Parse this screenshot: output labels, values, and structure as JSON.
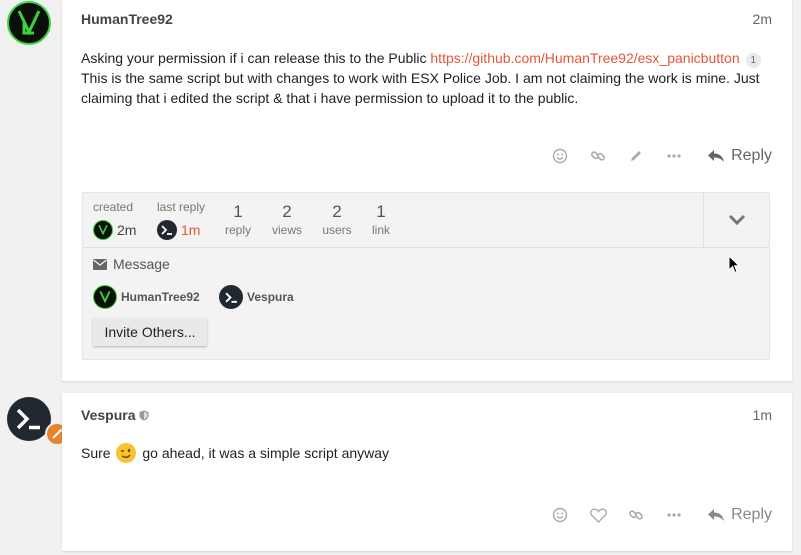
{
  "post1": {
    "username": "HumanTree92",
    "date": "2m",
    "text_before_link": "Asking your permission if i can release this to the Public ",
    "link_text": "https://github.com/HumanTree92/esx_panicbutton",
    "link_clicks": "1",
    "text_after": "This is the same script but with changes to work with ESX Police Job. I am not claiming the work is mine. Just claiming that i edited the script & that i have permission to upload it to the public.",
    "reply_label": "Reply"
  },
  "topic_map": {
    "created_label": "created",
    "created_time": "2m",
    "last_reply_label": "last reply",
    "last_reply_time": "1m",
    "stats": [
      {
        "value": "1",
        "label": "reply"
      },
      {
        "value": "2",
        "label": "views"
      },
      {
        "value": "2",
        "label": "users"
      },
      {
        "value": "1",
        "label": "link"
      }
    ],
    "message_label": "Message",
    "participants": [
      "HumanTree92",
      "Vespura"
    ],
    "invite_label": "Invite Others..."
  },
  "post2": {
    "username": "Vespura",
    "date": "1m",
    "text_before_emoji": "Sure ",
    "text_after_emoji": " go ahead, it was a simple script anyway",
    "reply_label": "Reply"
  },
  "colors": {
    "link": "#e45735",
    "accent_green": "#3bd23b",
    "moderator_badge": "#e8832e"
  }
}
